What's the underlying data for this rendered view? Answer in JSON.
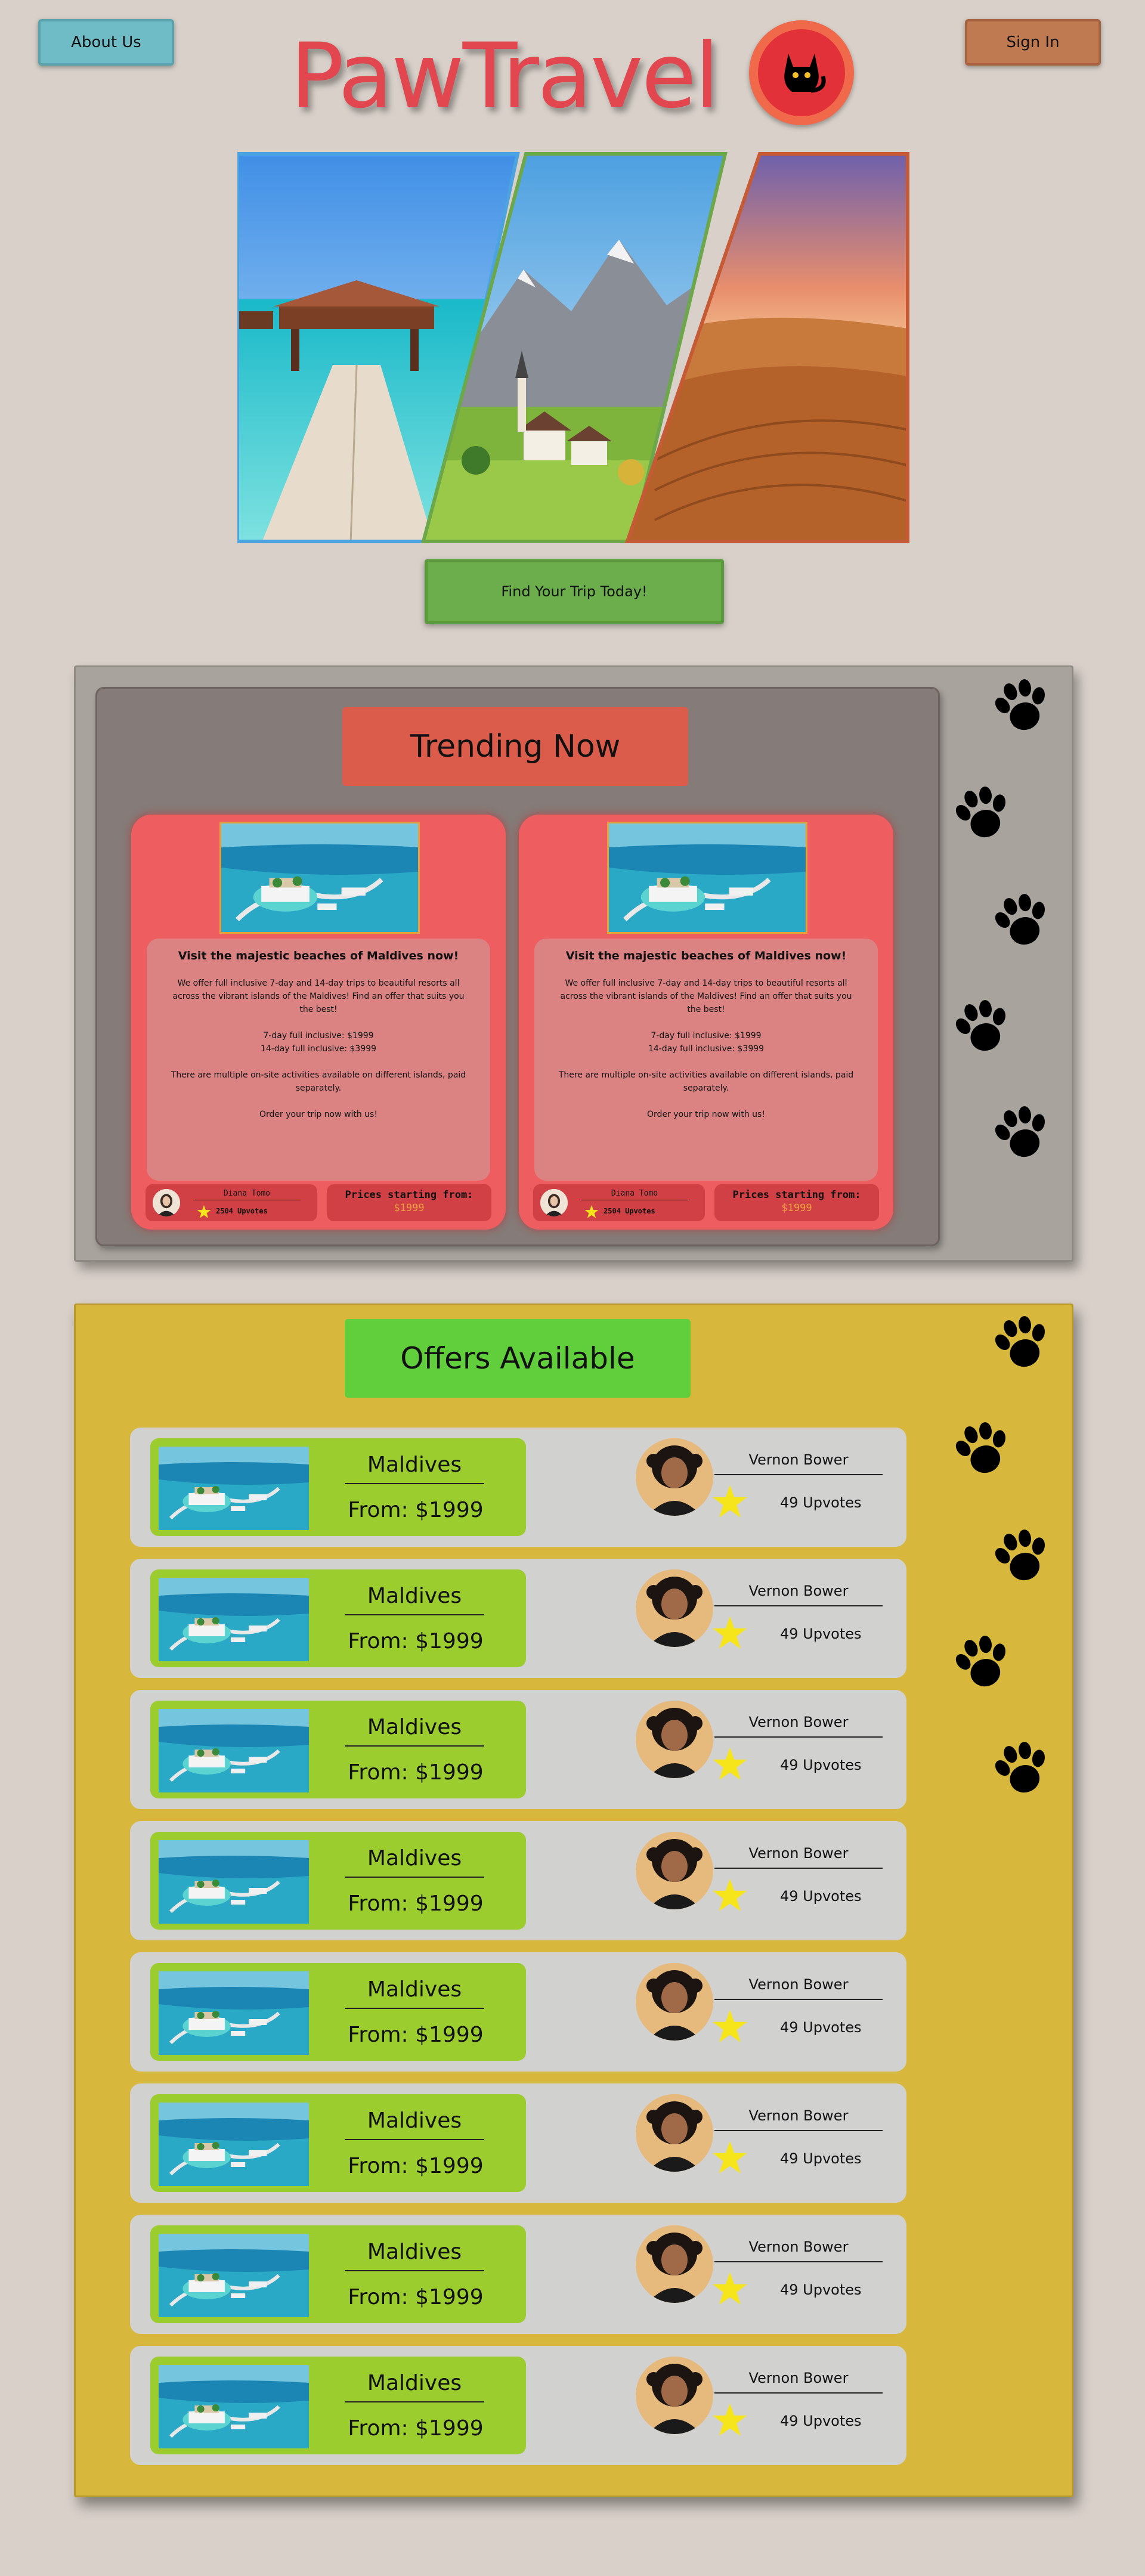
{
  "header": {
    "about_label": "About Us",
    "brand": "PawTravel",
    "signin_label": "Sign In",
    "logo_icon": "black-cat-icon"
  },
  "hero": {
    "cta_label": "Find Your Trip Today!",
    "images": [
      "maldives-pier-image",
      "alpine-village-image",
      "desert-dunes-image"
    ]
  },
  "trending": {
    "heading": "Trending Now",
    "cards": [
      {
        "title": "Visit the majestic beaches of Maldives now!",
        "p1": "We offer full inclusive 7-day and 14-day trips to beautiful resorts all across the vibrant islands of the Maldives! Find an offer that suits you the best!",
        "p2a": "7-day full inclusive: $1999",
        "p2b": "14-day full inclusive: $3999",
        "p3": "There are multiple on-site activities available on different islands, paid separately.",
        "p4": "Order your trip now with us!",
        "author": "Diana Tomo",
        "upvotes": "2504 Upvotes",
        "price_label": "Prices starting from:",
        "price": "$1999"
      },
      {
        "title": "Visit the majestic beaches of Maldives now!",
        "p1": "We offer full inclusive 7-day and 14-day trips to beautiful resorts all across the vibrant islands of the Maldives! Find an offer that suits you the best!",
        "p2a": "7-day full inclusive: $1999",
        "p2b": "14-day full inclusive: $3999",
        "p3": "There are multiple on-site activities available on different islands, paid separately.",
        "p4": "Order your trip now with us!",
        "author": "Diana Tomo",
        "upvotes": "2504 Upvotes",
        "price_label": "Prices starting from:",
        "price": "$1999"
      }
    ]
  },
  "offers": {
    "heading": "Offers Available",
    "items": [
      {
        "destination": "Maldives",
        "price": "From: $1999",
        "user": "Vernon Bower",
        "upvotes": "49 Upvotes"
      },
      {
        "destination": "Maldives",
        "price": "From: $1999",
        "user": "Vernon Bower",
        "upvotes": "49 Upvotes"
      },
      {
        "destination": "Maldives",
        "price": "From: $1999",
        "user": "Vernon Bower",
        "upvotes": "49 Upvotes"
      },
      {
        "destination": "Maldives",
        "price": "From: $1999",
        "user": "Vernon Bower",
        "upvotes": "49 Upvotes"
      },
      {
        "destination": "Maldives",
        "price": "From: $1999",
        "user": "Vernon Bower",
        "upvotes": "49 Upvotes"
      },
      {
        "destination": "Maldives",
        "price": "From: $1999",
        "user": "Vernon Bower",
        "upvotes": "49 Upvotes"
      },
      {
        "destination": "Maldives",
        "price": "From: $1999",
        "user": "Vernon Bower",
        "upvotes": "49 Upvotes"
      },
      {
        "destination": "Maldives",
        "price": "From: $1999",
        "user": "Vernon Bower",
        "upvotes": "49 Upvotes"
      }
    ]
  },
  "colors": {
    "page_bg": "#d8d0c9",
    "brand": "#e2474f",
    "trending_panel": "#a8a39d",
    "trending_card": "#ee5d5f",
    "offers_panel": "#d8b83c",
    "offer_green": "#9ccd2f",
    "cta": "#6cad4c"
  },
  "decor": {
    "paw_icon": "paw-print-icon",
    "star_icon": "star-icon"
  }
}
